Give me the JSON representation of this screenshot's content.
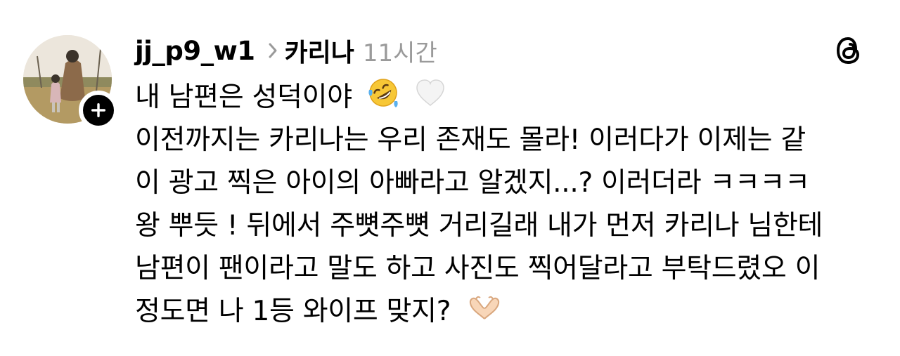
{
  "post": {
    "username": "jj_p9_w1",
    "tagged": "카리나",
    "time": "11시간",
    "lines": [
      "내 남편은 성덕이야",
      "이전까지는 카리나는 우리 존재도 몰라! 이러다가 이제는 같",
      "이 광고 찍은 아이의 아빠라고 알겠지...? 이러더라 ㅋㅋㅋㅋ",
      "왕 뿌듯 ! 뒤에서 주뼛주뼛 거리길래 내가 먼저 카리나 님한테",
      "남편이 팬이라고 말도 하고 사진도 찍어달라고 부탁드렸오 이",
      "정도면 나 1등 와이프 맞지?"
    ]
  },
  "icons": {
    "avatar": "profile-photo",
    "follow": "plus-icon",
    "separator": "chevron-right-icon",
    "app": "threads-logo-icon",
    "emoji_1": "rolling-on-floor-laughing-emoji",
    "emoji_2": "white-heart-emoji",
    "emoji_3": "heart-hands-emoji"
  },
  "colors": {
    "text": "#000000",
    "muted": "#9a9a9a",
    "background": "#ffffff"
  }
}
